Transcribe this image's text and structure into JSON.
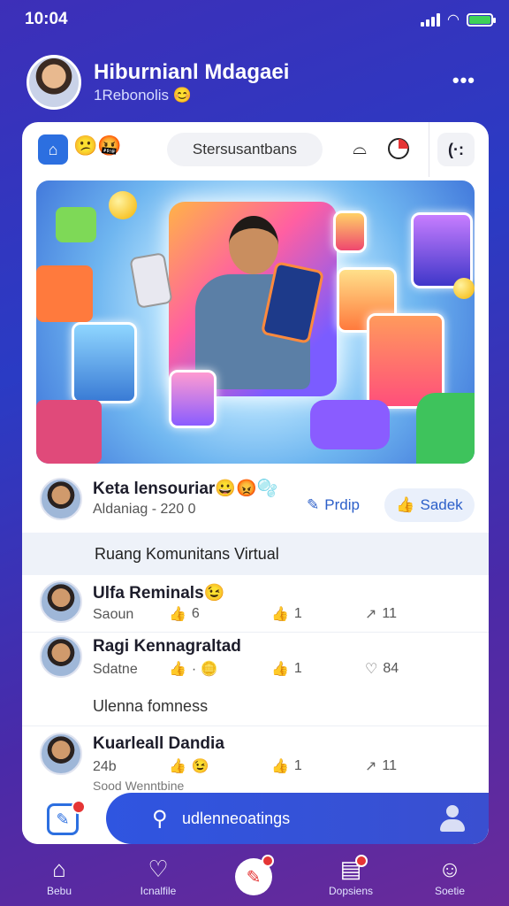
{
  "status_bar": {
    "time": "10:04"
  },
  "profile": {
    "name": "Hiburnianl Mdagaei",
    "subtitle": "1Rebonolis 😊"
  },
  "toolbar": {
    "emojis": "😕🤬",
    "pill_label": "Stersusantbans"
  },
  "post": {
    "author": "Keta lensouriar😀😡🫧",
    "meta": "Aldaniag - 220 0",
    "profile_action": "Prdip",
    "like_action": "Sadek"
  },
  "section_title": "Ruang Komunitans Virtual",
  "rows": [
    {
      "name": "Ulfa Reminals😉",
      "meta": "Saoun",
      "stat1": "6",
      "stat2": "1",
      "stat3": "11"
    },
    {
      "name": "Ragi Kennagraltad",
      "meta": "Sdatne",
      "stat1": "· 🪙",
      "stat2": "1",
      "stat3": "84"
    }
  ],
  "group_label": "Ulenna fomness",
  "row3": {
    "name": "Kuarleall Dandia",
    "meta": "24b",
    "stat1": "😉",
    "stat2": "1",
    "stat3": "11",
    "overflow": "Sood Wenntbine"
  },
  "search": {
    "placeholder": "udlenneoatings"
  },
  "tabs": [
    {
      "label": "Bebu",
      "icon": "home-icon"
    },
    {
      "label": "Icnalfile",
      "icon": "heart-person-icon"
    },
    {
      "label": "",
      "icon": "center-action-icon"
    },
    {
      "label": "Dopsiens",
      "icon": "inbox-icon"
    },
    {
      "label": "Soetie",
      "icon": "user-icon"
    }
  ],
  "colors": {
    "accent": "#2c6fe0",
    "badge": "#e53535",
    "background": "#3d2fb8"
  }
}
